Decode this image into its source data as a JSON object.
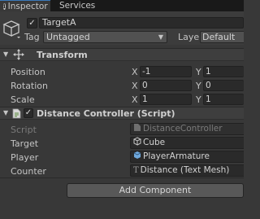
{
  "tabs": [
    {
      "label": "Inspector",
      "icon": "info-icon",
      "active": true
    },
    {
      "label": "Services",
      "active": false
    }
  ],
  "gameobject": {
    "active": true,
    "name": "TargetA",
    "tag_label": "Tag",
    "tag_value": "Untagged",
    "layer_label": "Layer",
    "layer_value": "Default"
  },
  "transform": {
    "title": "Transform",
    "rows": [
      {
        "label": "Position",
        "x": "-1",
        "y": "1"
      },
      {
        "label": "Rotation",
        "x": "0",
        "y": "0"
      },
      {
        "label": "Scale",
        "x": "1",
        "y": "1"
      }
    ],
    "x_axis": "X",
    "y_axis": "Y"
  },
  "distance_controller": {
    "title": "Distance Controller (Script)",
    "enabled": true,
    "fields": [
      {
        "label": "Script",
        "value": "DistanceController",
        "icon": "script-icon",
        "disabled": true
      },
      {
        "label": "Target",
        "value": "Cube",
        "icon": "gameobject-icon",
        "disabled": false
      },
      {
        "label": "Player",
        "value": "PlayerArmature",
        "icon": "prefab-icon",
        "disabled": false
      },
      {
        "label": "Counter",
        "value": "Distance (Text Mesh)",
        "icon": "textmesh-icon",
        "disabled": false
      }
    ]
  },
  "add_component_label": "Add Component",
  "colors": {
    "background": "#383838",
    "tab_bar": "#191919",
    "field": "#2a2a2a",
    "accent": "#3a79bb",
    "prefab_blue": "#6fa8dc"
  }
}
